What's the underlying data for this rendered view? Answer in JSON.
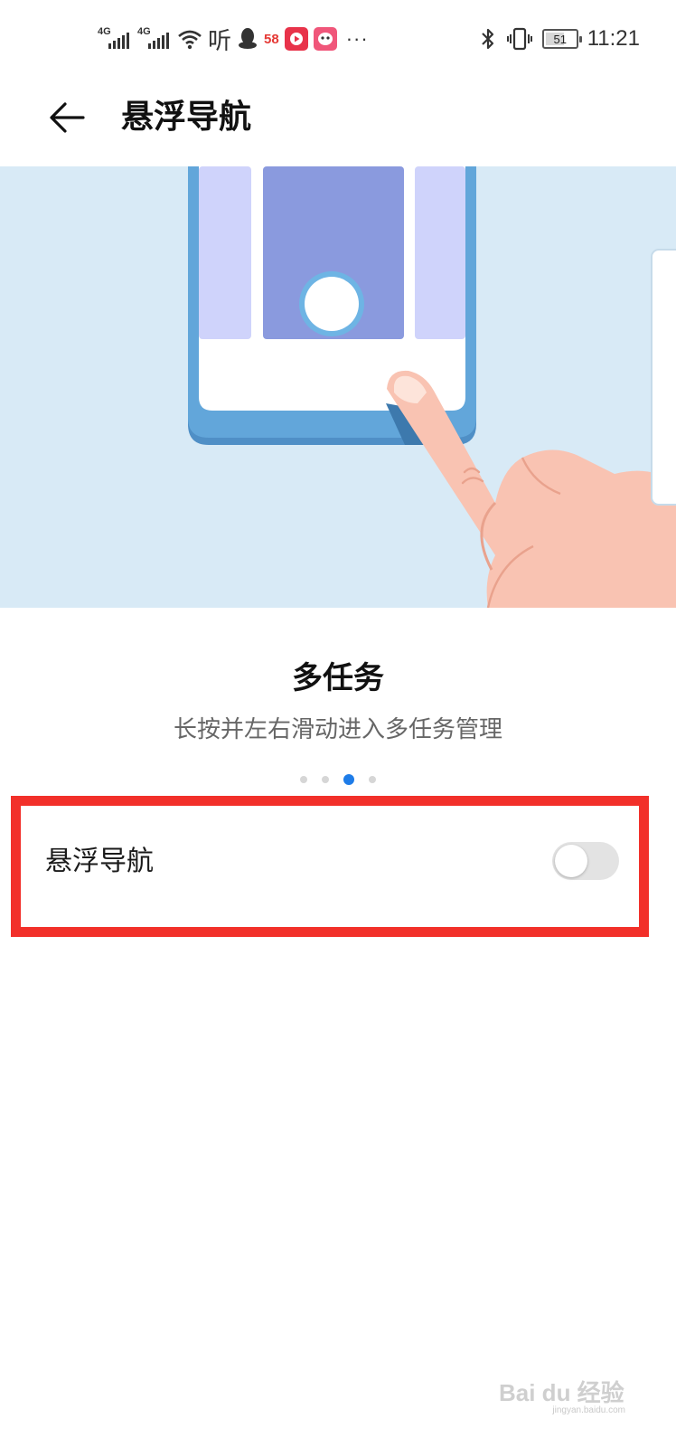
{
  "status_bar": {
    "signal_1": "4G",
    "signal_2": "4G",
    "listen_app": "听",
    "app_58": "58",
    "more": "···",
    "battery_level": "51",
    "time": "11:21"
  },
  "header": {
    "title": "悬浮导航"
  },
  "tutorial": {
    "title": "多任务",
    "description": "长按并左右滑动进入多任务管理",
    "page_count": 4,
    "active_page": 3
  },
  "setting": {
    "label": "悬浮导航",
    "enabled": false
  },
  "watermark": {
    "text": "Bai du 经验",
    "sub": "jingyan.baidu.com"
  },
  "colors": {
    "hero_background": "#d8eaf6",
    "accent": "#1e7ce8",
    "highlight_border": "#f2302a",
    "toggle_off": "#e3e3e3"
  },
  "icons": [
    "back-arrow-icon",
    "signal-icon",
    "wifi-icon",
    "qq-icon",
    "app-video-icon",
    "app-cartoon-icon",
    "bluetooth-icon",
    "vibrate-icon",
    "battery-icon"
  ]
}
